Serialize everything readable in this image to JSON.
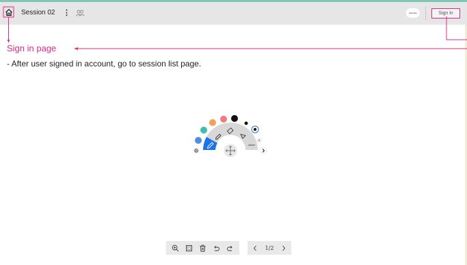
{
  "header": {
    "session_title": "Session 02",
    "more_icon": "⋮",
    "avatar_label": "Attendee",
    "signin_label": "Sign in",
    "accent_color": "#de2a85"
  },
  "annotation": {
    "title": "Sign in page",
    "description": "- After user signed in account, go to session list page."
  },
  "palette": {
    "colors": [
      "#4a90e2",
      "#3cbfae",
      "#f5a05a",
      "#ef7b7b",
      "#111111",
      "#111111"
    ],
    "tools": [
      "pen",
      "highlighter",
      "eraser",
      "select",
      "sticker"
    ],
    "sticker_label": "sticker",
    "active_tool": "pen"
  },
  "bottom_toolbar": {
    "tools": [
      "zoom-in",
      "fit-screen",
      "delete",
      "undo",
      "redo"
    ]
  },
  "pager": {
    "page_indicator": "1/2"
  }
}
